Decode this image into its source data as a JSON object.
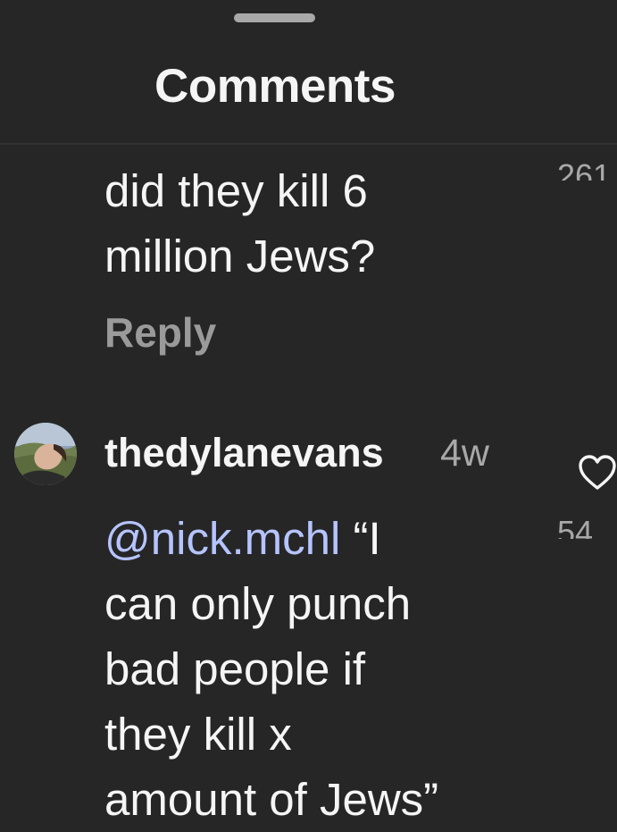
{
  "header": {
    "title": "Comments"
  },
  "comments": [
    {
      "text": "did they kill 6\nmillion Jews?",
      "likes": "261",
      "reply_label": "Reply"
    },
    {
      "username": "thedylanevans",
      "time": "4w",
      "mention": "@nick.mchl",
      "text": " “I\ncan only punch\nbad people if\nthey kill x\namount of Jews”",
      "likes": "54",
      "avatar_icon": "user-avatar-photo"
    }
  ],
  "colors": {
    "background": "#262626",
    "text": "#f5f5f5",
    "secondary": "#a8a8a8",
    "mention": "#b5c4ff"
  }
}
